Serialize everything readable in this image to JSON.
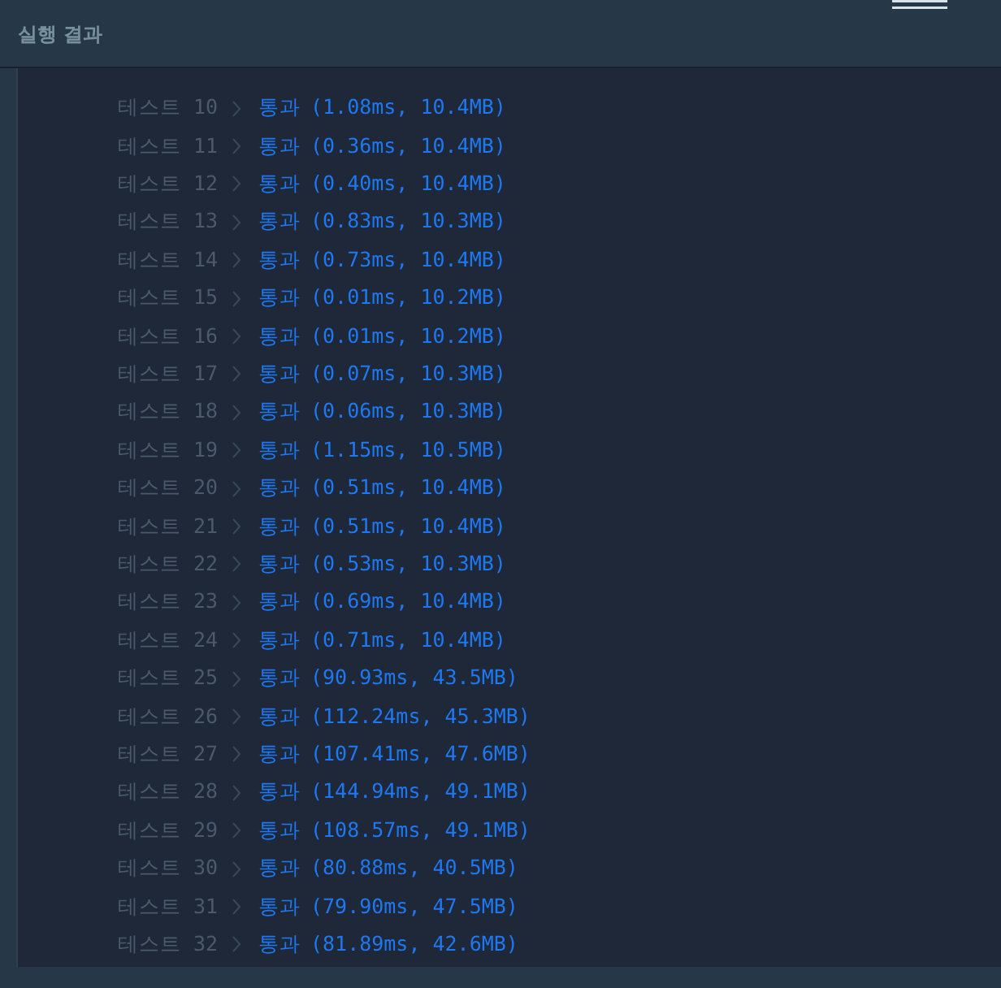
{
  "panel": {
    "title": "실행 결과"
  },
  "tests": [
    {
      "label": "테스트 10",
      "status": "통과",
      "detail": "(1.08ms, 10.4MB)"
    },
    {
      "label": "테스트 11",
      "status": "통과",
      "detail": "(0.36ms, 10.4MB)"
    },
    {
      "label": "테스트 12",
      "status": "통과",
      "detail": "(0.40ms, 10.4MB)"
    },
    {
      "label": "테스트 13",
      "status": "통과",
      "detail": "(0.83ms, 10.3MB)"
    },
    {
      "label": "테스트 14",
      "status": "통과",
      "detail": "(0.73ms, 10.4MB)"
    },
    {
      "label": "테스트 15",
      "status": "통과",
      "detail": "(0.01ms, 10.2MB)"
    },
    {
      "label": "테스트 16",
      "status": "통과",
      "detail": "(0.01ms, 10.2MB)"
    },
    {
      "label": "테스트 17",
      "status": "통과",
      "detail": "(0.07ms, 10.3MB)"
    },
    {
      "label": "테스트 18",
      "status": "통과",
      "detail": "(0.06ms, 10.3MB)"
    },
    {
      "label": "테스트 19",
      "status": "통과",
      "detail": "(1.15ms, 10.5MB)"
    },
    {
      "label": "테스트 20",
      "status": "통과",
      "detail": "(0.51ms, 10.4MB)"
    },
    {
      "label": "테스트 21",
      "status": "통과",
      "detail": "(0.51ms, 10.4MB)"
    },
    {
      "label": "테스트 22",
      "status": "통과",
      "detail": "(0.53ms, 10.3MB)"
    },
    {
      "label": "테스트 23",
      "status": "통과",
      "detail": "(0.69ms, 10.4MB)"
    },
    {
      "label": "테스트 24",
      "status": "통과",
      "detail": "(0.71ms, 10.4MB)"
    },
    {
      "label": "테스트 25",
      "status": "통과",
      "detail": "(90.93ms, 43.5MB)"
    },
    {
      "label": "테스트 26",
      "status": "통과",
      "detail": "(112.24ms, 45.3MB)"
    },
    {
      "label": "테스트 27",
      "status": "통과",
      "detail": "(107.41ms, 47.6MB)"
    },
    {
      "label": "테스트 28",
      "status": "통과",
      "detail": "(144.94ms, 49.1MB)"
    },
    {
      "label": "테스트 29",
      "status": "통과",
      "detail": "(108.57ms, 49.1MB)"
    },
    {
      "label": "테스트 30",
      "status": "통과",
      "detail": "(80.88ms, 40.5MB)"
    },
    {
      "label": "테스트 31",
      "status": "통과",
      "detail": "(79.90ms, 47.5MB)"
    },
    {
      "label": "테스트 32",
      "status": "통과",
      "detail": "(81.89ms, 42.6MB)"
    }
  ]
}
